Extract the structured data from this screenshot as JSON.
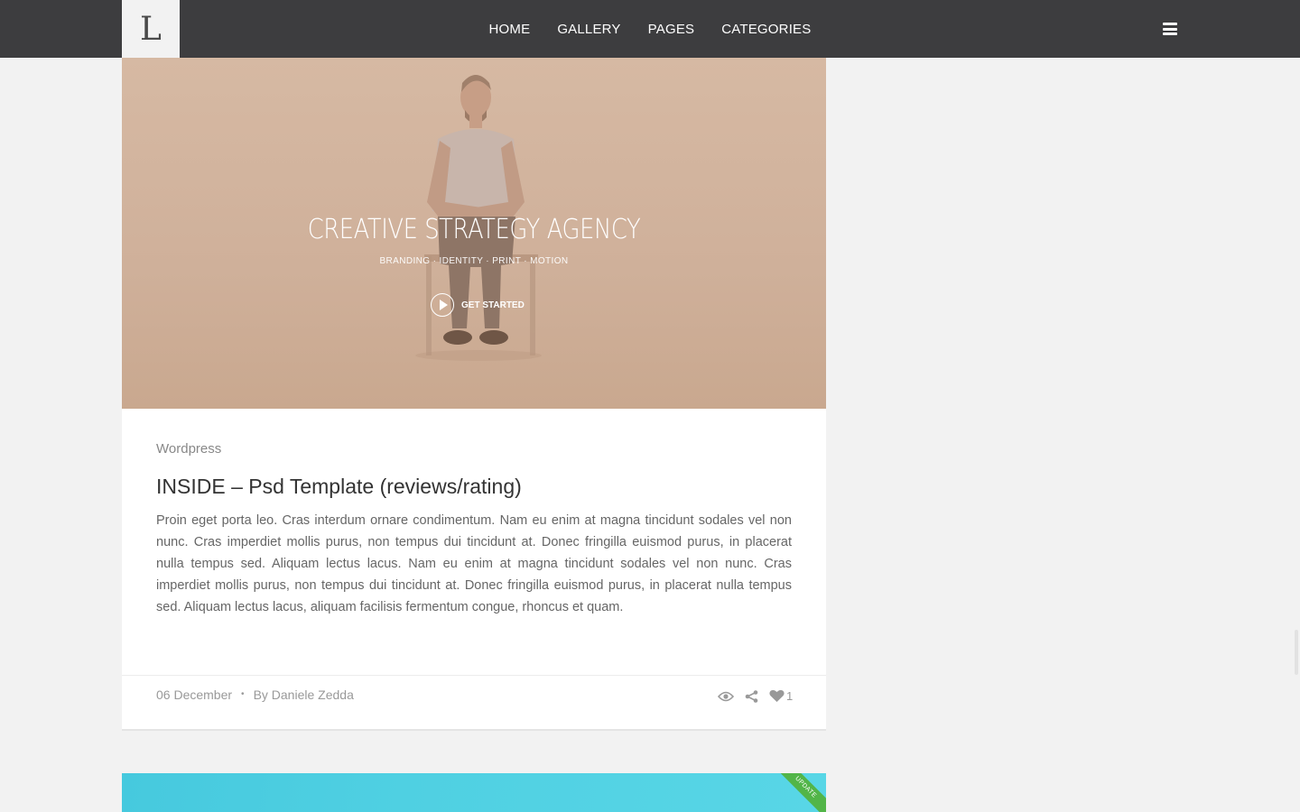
{
  "header": {
    "logo_letter": "L",
    "nav": [
      "HOME",
      "GALLERY",
      "PAGES",
      "CATEGORIES"
    ],
    "menu_icon": "hamburger-icon"
  },
  "post": {
    "hero": {
      "headline": "CREATIVE STRATEGY AGENCY",
      "tagline": "BRANDING · IDENTITY · PRINT · MOTION",
      "cta_label": "GET STARTED",
      "cta_icon": "play-icon"
    },
    "category": "Wordpress",
    "title": "INSIDE – Psd Template (reviews/rating)",
    "excerpt": "Proin eget porta leo. Cras interdum ornare condimentum. Nam eu enim at magna tincidunt sodales vel non nunc. Cras imperdiet mollis purus, non tempus dui tincidunt at. Donec fringilla euismod purus, in placerat nulla tempus sed. Aliquam lectus lacus. Nam eu enim at magna tincidunt sodales vel non nunc. Cras imperdiet mollis purus, non tempus dui tincidunt at. Donec fringilla euismod purus, in placerat nulla tempus sed. Aliquam lectus lacus, aliquam facilisis fermentum congue, rhoncus et quam.",
    "date": "06 December",
    "separator": "•",
    "author": "By Daniele Zedda",
    "likes": "1",
    "icons": [
      "eye-icon",
      "share-icon",
      "heart-icon"
    ]
  },
  "next_post": {
    "ribbon": "UPDATE",
    "color": "#4fd0e2"
  },
  "colors": {
    "topbar": "#3d3d3f",
    "page_bg": "#f2f2f2",
    "hero_tint": "#d3b49e",
    "ribbon": "#52b548"
  }
}
